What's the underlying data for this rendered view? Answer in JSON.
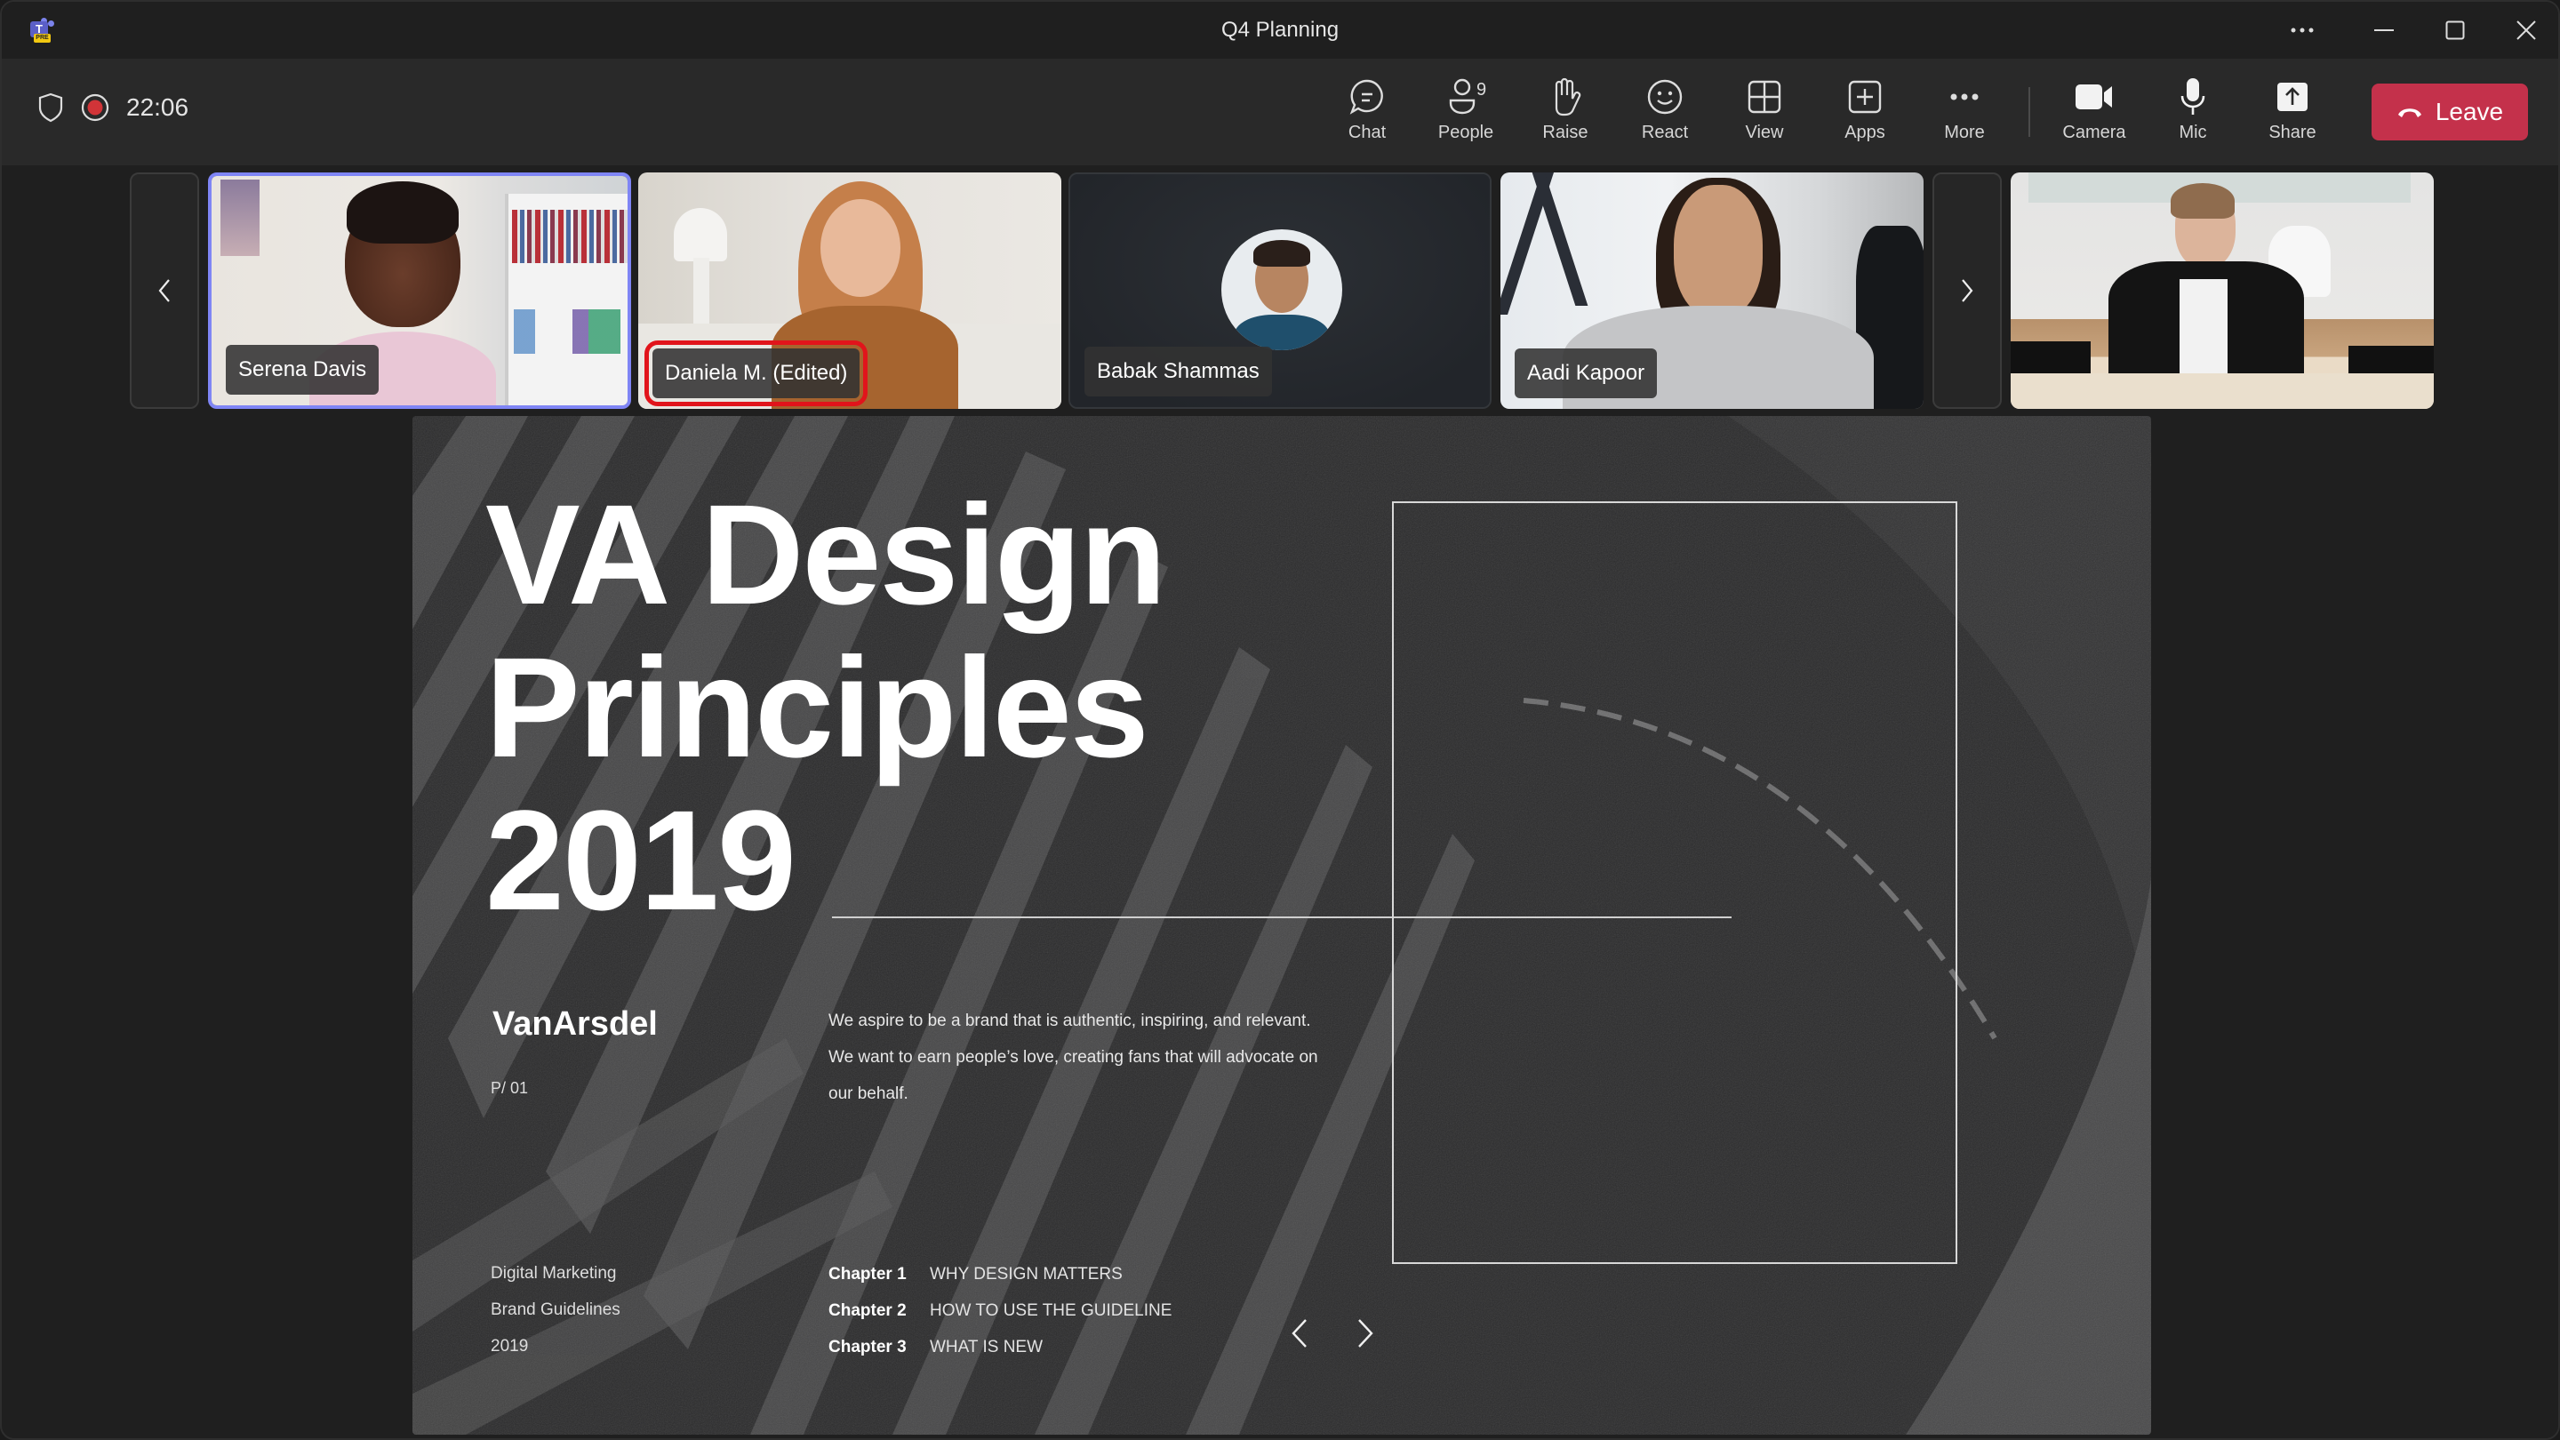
{
  "window": {
    "title": "Q4 Planning",
    "app_icon": "teams-preview-logo",
    "app_badge": "PRE",
    "controls": [
      {
        "name": "more-options",
        "icon": "ellipsis-icon"
      },
      {
        "name": "minimize",
        "icon": "minimize-icon"
      },
      {
        "name": "maximize",
        "icon": "maximize-icon"
      },
      {
        "name": "close",
        "icon": "close-icon"
      }
    ]
  },
  "toolbar": {
    "security_icon": "shield-icon",
    "recording_icon": "record-icon",
    "elapsed": "22:06",
    "buttons": [
      {
        "id": "chat",
        "label": "Chat",
        "icon": "chat-icon"
      },
      {
        "id": "people",
        "label": "People",
        "icon": "people-icon",
        "count": "9"
      },
      {
        "id": "raise",
        "label": "Raise",
        "icon": "hand-icon"
      },
      {
        "id": "react",
        "label": "React",
        "icon": "smiley-icon"
      },
      {
        "id": "view",
        "label": "View",
        "icon": "grid-icon"
      },
      {
        "id": "apps",
        "label": "Apps",
        "icon": "plus-square-icon"
      },
      {
        "id": "more",
        "label": "More",
        "icon": "ellipsis-icon"
      },
      {
        "id": "camera",
        "label": "Camera",
        "icon": "camera-icon"
      },
      {
        "id": "mic",
        "label": "Mic",
        "icon": "mic-icon"
      },
      {
        "id": "share",
        "label": "Share",
        "icon": "share-icon"
      }
    ],
    "leave": {
      "label": "Leave",
      "icon": "hang-up-icon",
      "color": "#c4314b"
    }
  },
  "participants": [
    {
      "name": "Serena Davis",
      "active_speaker": true
    },
    {
      "name": "Daniela M. (Edited)",
      "highlighted": true
    },
    {
      "name": "Babak Shammas",
      "video": false
    },
    {
      "name": "Aadi Kapoor"
    },
    {
      "name": ""
    }
  ],
  "accent_color": "#7f85f5",
  "slide": {
    "title_lines": [
      "VA Design",
      "Principles",
      "2019"
    ],
    "brand": "VanArsdel",
    "page": "P/ 01",
    "description": "We aspire to be a brand that is authentic, inspiring, and relevant. We want to earn people’s love, creating fans that will advocate on our behalf.",
    "meta": [
      "Digital Marketing",
      "Brand Guidelines",
      "2019"
    ],
    "chapters": [
      {
        "label": "Chapter 1",
        "title": "WHY DESIGN MATTERS"
      },
      {
        "label": "Chapter 2",
        "title": "HOW TO USE THE GUIDELINE"
      },
      {
        "label": "Chapter 3",
        "title": "WHAT IS NEW"
      }
    ]
  }
}
